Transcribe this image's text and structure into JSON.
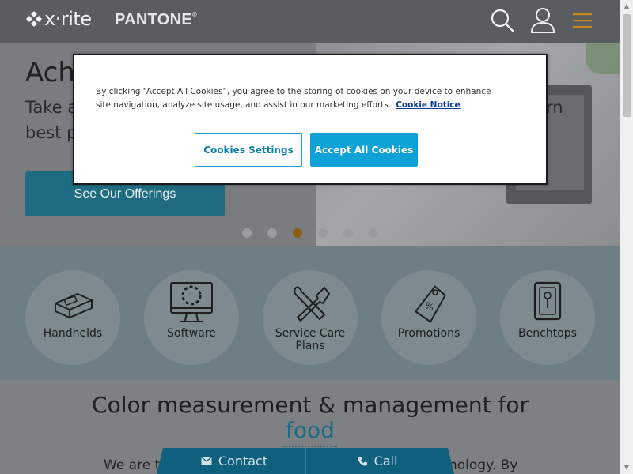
{
  "header": {
    "brand_xrite": "x·rite",
    "brand_pantone": "PANTONE",
    "brand_pantone_mark": "®",
    "icons": [
      "search-icon",
      "user-icon",
      "hamburger-menu-icon"
    ],
    "accent_color": "#c8891a"
  },
  "hero": {
    "title": "Achi",
    "subtitle_line1_left": "Take a",
    "subtitle_line1_right": "rn",
    "subtitle_line2": "best pr",
    "cta_label": "See Our Offerings",
    "carousel": {
      "slides": 6,
      "active_index": 2
    }
  },
  "categories": [
    {
      "label": "Handhelds",
      "icon": "handheld-device-icon"
    },
    {
      "label": "Software",
      "icon": "monitor-icon"
    },
    {
      "label": "Service Care Plans",
      "icon": "tools-icon"
    },
    {
      "label": "Promotions",
      "icon": "price-tag-icon"
    },
    {
      "label": "Benchtops",
      "icon": "benchtop-device-icon"
    }
  ],
  "intro": {
    "title": "Color measurement & management for",
    "highlight": "food",
    "body_left": "We are th",
    "body_right": "nology. By"
  },
  "contact_bar": {
    "contact_label": "Contact",
    "call_label": "Call"
  },
  "cookie_banner": {
    "text": "By clicking “Accept All Cookies”, you agree to the storing of cookies on your device to enhance site navigation, analyze site usage, and assist in our marketing efforts.",
    "link_label": "Cookie Notice",
    "settings_label": "Cookies Settings",
    "accept_label": "Accept All Cookies",
    "accent_color": "#0ea2d6"
  }
}
